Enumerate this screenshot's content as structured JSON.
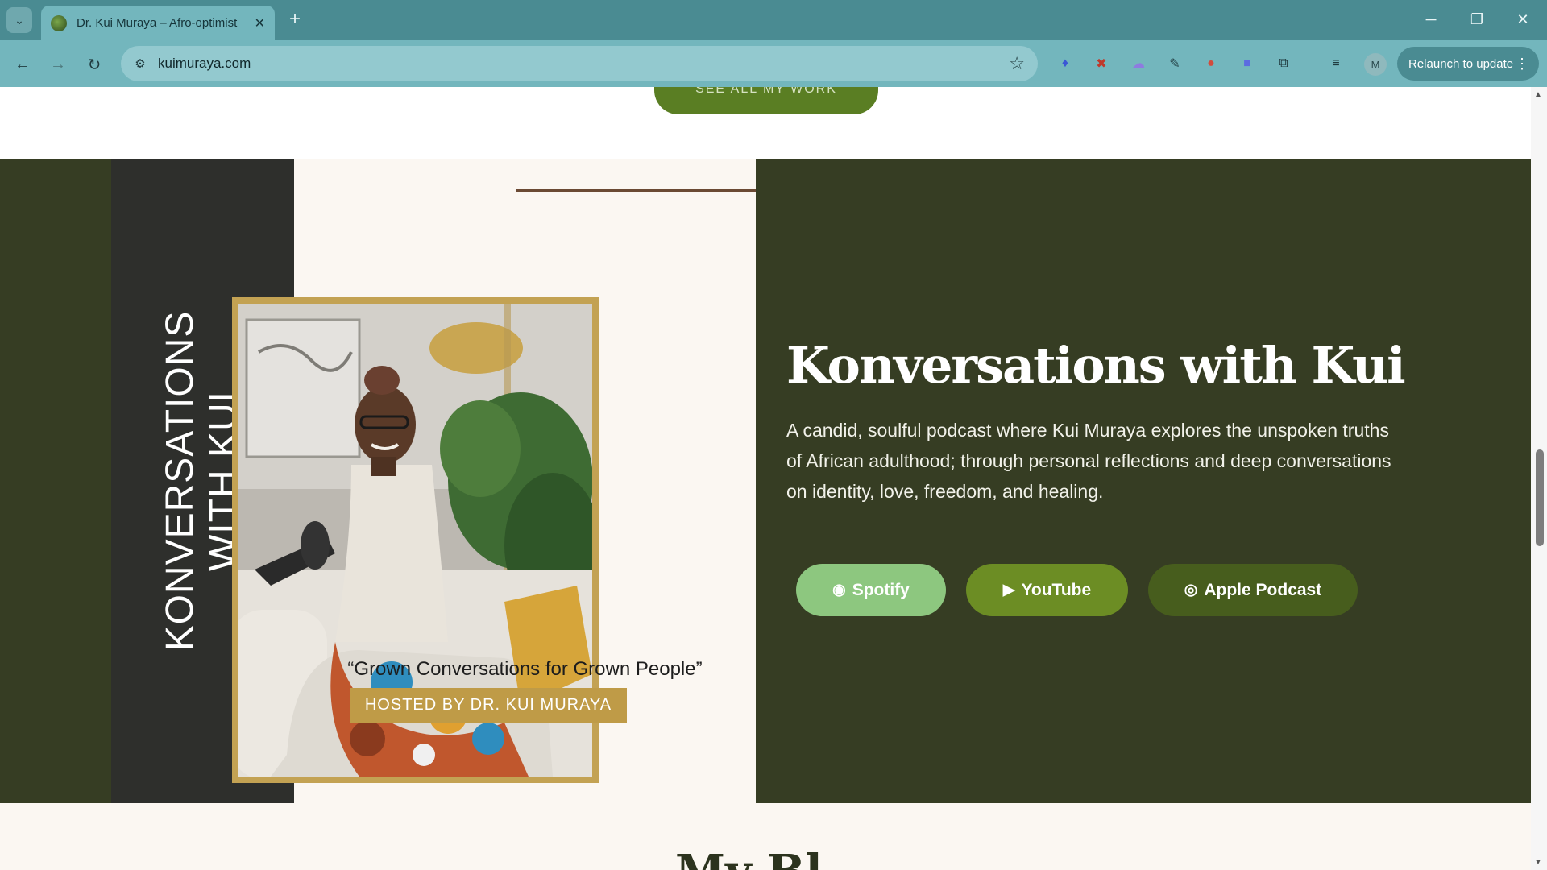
{
  "browser": {
    "tab_title": "Dr. Kui Muraya – Afro-optimist",
    "url": "kuimuraya.com",
    "profile_initial": "M",
    "relaunch_label": "Relaunch to update",
    "new_tab_label": "+"
  },
  "page": {
    "top_button_label": "SEE ALL MY WORK",
    "vertical_title": "KONVERSATIONS WITH KUI",
    "quote": "“Grown Conversations for Grown People”",
    "host_badge": "HOSTED BY DR. KUI MURAYA",
    "heading": "Konversations with Kui",
    "description": "A candid, soulful podcast where Kui Muraya explores the unspoken truths of African adulthood; through personal reflections and deep conversations on identity, love, freedom, and healing.",
    "buttons": {
      "spotify": "Spotify",
      "youtube": "YouTube",
      "apple": "Apple Podcast"
    },
    "next_section_title": "My Bl"
  },
  "colors": {
    "dark_olive": "#363d23",
    "cream": "#fbf7f2",
    "gold": "#bf9b47",
    "spotify_green": "#8dc77f",
    "youtube_green": "#6c8d24",
    "apple_green": "#475d1d"
  }
}
